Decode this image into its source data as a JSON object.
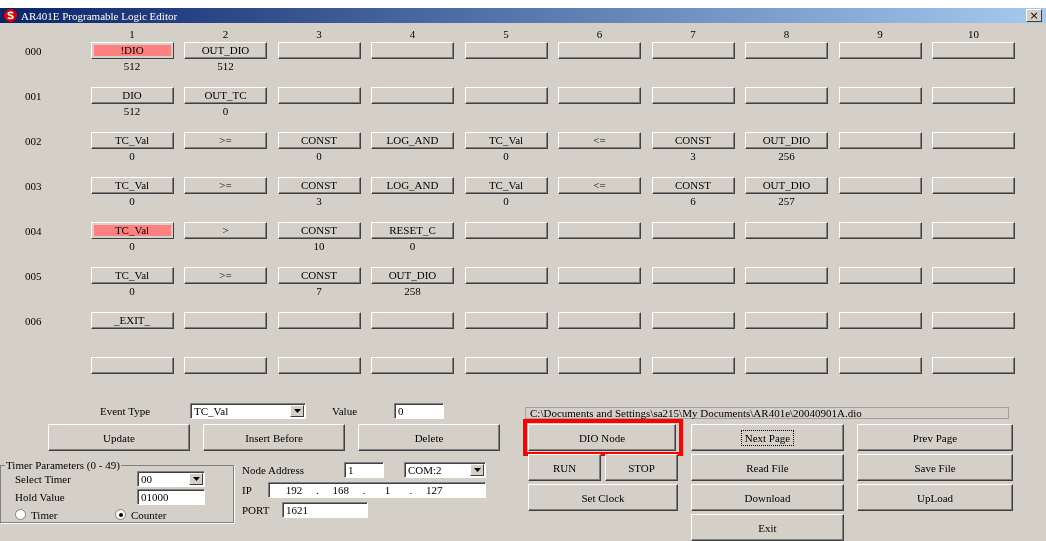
{
  "window": {
    "title": "AR401E Programable Logic Editor",
    "close": "×"
  },
  "grid": {
    "columns": [
      "1",
      "2",
      "3",
      "4",
      "5",
      "6",
      "7",
      "8",
      "9",
      "10"
    ],
    "rows": [
      {
        "label": "000",
        "cells": [
          {
            "text": "!DIO",
            "value": "512",
            "selected": true
          },
          {
            "text": "OUT_DIO",
            "value": "512",
            "selected": false
          },
          {
            "selected": false
          },
          {
            "selected": false
          },
          {
            "selected": false
          },
          {
            "selected": false
          },
          {
            "selected": false
          },
          {
            "selected": false
          },
          {
            "selected": false
          },
          {
            "selected": false
          }
        ]
      },
      {
        "label": "001",
        "cells": [
          {
            "text": "DIO",
            "value": "512",
            "selected": false
          },
          {
            "text": "OUT_TC",
            "value": "0",
            "selected": false
          },
          {
            "selected": false
          },
          {
            "selected": false
          },
          {
            "selected": false
          },
          {
            "selected": false
          },
          {
            "selected": false
          },
          {
            "selected": false
          },
          {
            "selected": false
          },
          {
            "selected": false
          }
        ]
      },
      {
        "label": "002",
        "cells": [
          {
            "text": "TC_Val",
            "value": "0",
            "selected": false
          },
          {
            "text": ">=",
            "selected": false
          },
          {
            "text": "CONST",
            "value": "0",
            "selected": false
          },
          {
            "text": "LOG_AND",
            "selected": false
          },
          {
            "text": "TC_Val",
            "value": "0",
            "selected": false
          },
          {
            "text": "<=",
            "selected": false
          },
          {
            "text": "CONST",
            "value": "3",
            "selected": false
          },
          {
            "text": "OUT_DIO",
            "value": "256",
            "selected": false
          },
          {
            "selected": false
          },
          {
            "selected": false
          }
        ]
      },
      {
        "label": "003",
        "cells": [
          {
            "text": "TC_Val",
            "value": "0",
            "selected": false
          },
          {
            "text": ">=",
            "selected": false
          },
          {
            "text": "CONST",
            "value": "3",
            "selected": false
          },
          {
            "text": "LOG_AND",
            "selected": false
          },
          {
            "text": "TC_Val",
            "value": "0",
            "selected": false
          },
          {
            "text": "<=",
            "selected": false
          },
          {
            "text": "CONST",
            "value": "6",
            "selected": false
          },
          {
            "text": "OUT_DIO",
            "value": "257",
            "selected": false
          },
          {
            "selected": false
          },
          {
            "selected": false
          }
        ]
      },
      {
        "label": "004",
        "cells": [
          {
            "text": "TC_Val",
            "value": "0",
            "selected": true
          },
          {
            "text": ">",
            "selected": false
          },
          {
            "text": "CONST",
            "value": "10",
            "selected": false
          },
          {
            "text": "RESET_C",
            "value": "0",
            "selected": false
          },
          {
            "selected": false
          },
          {
            "selected": false
          },
          {
            "selected": false
          },
          {
            "selected": false
          },
          {
            "selected": false
          },
          {
            "selected": false
          }
        ]
      },
      {
        "label": "005",
        "cells": [
          {
            "text": "TC_Val",
            "value": "0",
            "selected": false
          },
          {
            "text": ">=",
            "selected": false
          },
          {
            "text": "CONST",
            "value": "7",
            "selected": false
          },
          {
            "text": "OUT_DIO",
            "value": "258",
            "selected": false
          },
          {
            "selected": false
          },
          {
            "selected": false
          },
          {
            "selected": false
          },
          {
            "selected": false
          },
          {
            "selected": false
          },
          {
            "selected": false
          }
        ]
      },
      {
        "label": "006",
        "cells": [
          {
            "text": "_EXIT_",
            "selected": false
          },
          {
            "selected": false
          },
          {
            "selected": false
          },
          {
            "selected": false
          },
          {
            "selected": false
          },
          {
            "selected": false
          },
          {
            "selected": false
          },
          {
            "selected": false
          },
          {
            "selected": false
          },
          {
            "selected": false
          }
        ]
      },
      {
        "cells": [
          {
            "selected": false
          },
          {
            "selected": false
          },
          {
            "selected": false
          },
          {
            "selected": false
          },
          {
            "selected": false
          },
          {
            "selected": false
          },
          {
            "selected": false
          },
          {
            "selected": false
          },
          {
            "selected": false
          },
          {
            "selected": false
          }
        ]
      }
    ]
  },
  "editor": {
    "event_type_label": "Event Type",
    "event_type": "TC_Val",
    "value_label": "Value",
    "value": "0",
    "buttons": [
      "Update",
      "Insert Before",
      "Delete"
    ]
  },
  "timer": {
    "title": "Timer Parameters (0 - 49)",
    "select_label": "Select Timer",
    "select_value": "00",
    "hold_label": "Hold Value",
    "hold_value": "01000",
    "modes": [
      {
        "label": "Timer",
        "selected": false
      },
      {
        "label": "Counter",
        "selected": true
      }
    ]
  },
  "network": {
    "node_label": "Node Address",
    "node_value": "1",
    "com_port": "COM:2",
    "ip_label": "IP",
    "ip": [
      "192",
      "168",
      "1",
      "127"
    ],
    "ip_separator": ".",
    "port_label": "PORT",
    "port": "1621"
  },
  "file_path": "C:\\Documents and Settings\\sa215\\My Documents\\AR401e\\20040901A.dio",
  "actions": [
    [
      {
        "label": "DIO Node",
        "focused": false,
        "highlighted": true
      },
      {
        "label": "RUN",
        "focused": false,
        "highlighted": false
      },
      {
        "label": "STOP",
        "focused": false,
        "highlighted": false
      },
      {
        "label": "Set Clock",
        "focused": false,
        "highlighted": false
      }
    ],
    [
      {
        "label": "Next Page",
        "focused": true,
        "highlighted": false
      },
      {
        "label": "Read File",
        "focused": false,
        "highlighted": false
      },
      {
        "label": "Download",
        "focused": false,
        "highlighted": false
      },
      {
        "label": "Exit",
        "focused": false,
        "highlighted": false
      }
    ],
    [
      {
        "label": "Prev Page",
        "focused": false,
        "highlighted": false
      },
      {
        "label": "Save File",
        "focused": false,
        "highlighted": false
      },
      {
        "label": "UpLoad",
        "focused": false,
        "highlighted": false
      }
    ]
  ]
}
